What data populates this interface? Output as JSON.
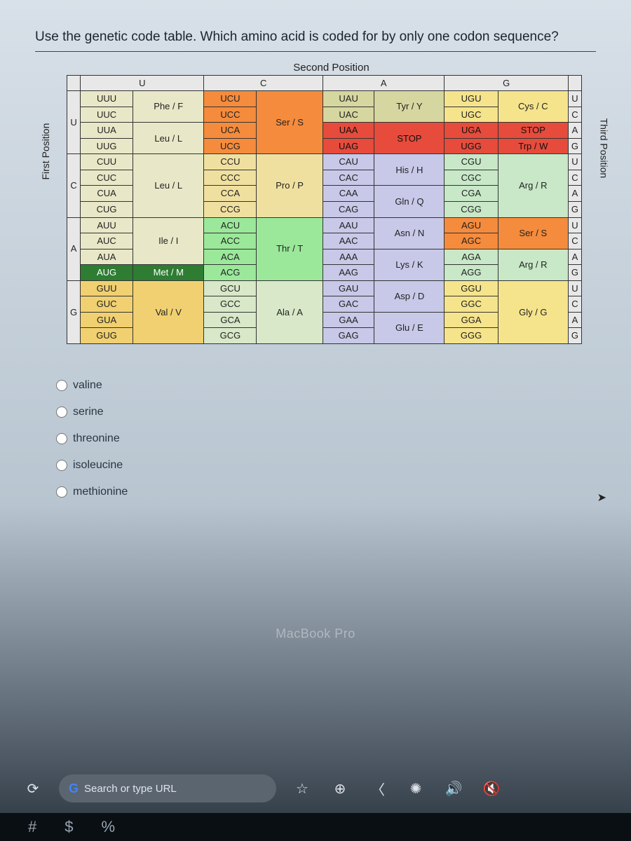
{
  "question": "Use the genetic code table. Which amino acid is coded for by only one codon sequence?",
  "labels": {
    "second": "Second Position",
    "first": "First Position",
    "third": "Third Position"
  },
  "headers": {
    "U": "U",
    "C": "C",
    "A": "A",
    "G": "G"
  },
  "rows": [
    "U",
    "C",
    "A",
    "G"
  ],
  "thirds": [
    "U",
    "C",
    "A",
    "G"
  ],
  "codon_table": {
    "U": {
      "U": {
        "codons": [
          "UUU",
          "UUC",
          "UUA",
          "UUG"
        ],
        "aa": [
          "Phe / F",
          "Phe / F",
          "Leu / L",
          "Leu / L"
        ]
      },
      "C": {
        "codons": [
          "UCU",
          "UCC",
          "UCA",
          "UCG"
        ],
        "aa": [
          "Ser / S",
          "Ser / S",
          "Ser / S",
          "Ser / S"
        ]
      },
      "A": {
        "codons": [
          "UAU",
          "UAC",
          "UAA",
          "UAG"
        ],
        "aa": [
          "Tyr / Y",
          "Tyr / Y",
          "STOP",
          "STOP"
        ]
      },
      "G": {
        "codons": [
          "UGU",
          "UGC",
          "UGA",
          "UGG"
        ],
        "aa": [
          "Cys / C",
          "Cys / C",
          "STOP",
          "Trp / W"
        ]
      }
    },
    "C": {
      "U": {
        "codons": [
          "CUU",
          "CUC",
          "CUA",
          "CUG"
        ],
        "aa": [
          "Leu / L",
          "Leu / L",
          "Leu / L",
          "Leu / L"
        ]
      },
      "C": {
        "codons": [
          "CCU",
          "CCC",
          "CCA",
          "CCG"
        ],
        "aa": [
          "Pro / P",
          "Pro / P",
          "Pro / P",
          "Pro / P"
        ]
      },
      "A": {
        "codons": [
          "CAU",
          "CAC",
          "CAA",
          "CAG"
        ],
        "aa": [
          "His / H",
          "His / H",
          "Gln / Q",
          "Gln / Q"
        ]
      },
      "G": {
        "codons": [
          "CGU",
          "CGC",
          "CGA",
          "CGG"
        ],
        "aa": [
          "Arg / R",
          "Arg / R",
          "Arg / R",
          "Arg / R"
        ]
      }
    },
    "A": {
      "U": {
        "codons": [
          "AUU",
          "AUC",
          "AUA",
          "AUG"
        ],
        "aa": [
          "Ile / I",
          "Ile / I",
          "Ile / I",
          "Met / M"
        ]
      },
      "C": {
        "codons": [
          "ACU",
          "ACC",
          "ACA",
          "ACG"
        ],
        "aa": [
          "Thr / T",
          "Thr / T",
          "Thr / T",
          "Thr / T"
        ]
      },
      "A": {
        "codons": [
          "AAU",
          "AAC",
          "AAA",
          "AAG"
        ],
        "aa": [
          "Asn / N",
          "Asn / N",
          "Lys / K",
          "Lys / K"
        ]
      },
      "G": {
        "codons": [
          "AGU",
          "AGC",
          "AGA",
          "AGG"
        ],
        "aa": [
          "Ser / S",
          "Ser / S",
          "Arg / R",
          "Arg / R"
        ]
      }
    },
    "G": {
      "U": {
        "codons": [
          "GUU",
          "GUC",
          "GUA",
          "GUG"
        ],
        "aa": [
          "Val / V",
          "Val / V",
          "Val / V",
          "Val / V"
        ]
      },
      "C": {
        "codons": [
          "GCU",
          "GCC",
          "GCA",
          "GCG"
        ],
        "aa": [
          "Ala / A",
          "Ala / A",
          "Ala / A",
          "Ala / A"
        ]
      },
      "A": {
        "codons": [
          "GAU",
          "GAC",
          "GAA",
          "GAG"
        ],
        "aa": [
          "Asp / D",
          "Asp / D",
          "Glu / E",
          "Glu / E"
        ]
      },
      "G": {
        "codons": [
          "GGU",
          "GGC",
          "GGA",
          "GGG"
        ],
        "aa": [
          "Gly / G",
          "Gly / G",
          "Gly / G",
          "Gly / G"
        ]
      }
    }
  },
  "aa_class": {
    "Phe / F": "phe",
    "Leu / L": "leu",
    "Ser / S": "ser",
    "Tyr / Y": "tyr",
    "STOP": "stop",
    "Cys / C": "cys",
    "Trp / W": "trp",
    "His / H": "his",
    "Gln / Q": "gln",
    "Pro / P": "pro",
    "Arg / R": "arg",
    "Ile / I": "ile",
    "Met / M": "met",
    "Thr / T": "thr",
    "Asn / N": "asn",
    "Lys / K": "lys",
    "Val / V": "val",
    "Ala / A": "ala",
    "Asp / D": "asp",
    "Glu / E": "glu",
    "Gly / G": "gly"
  },
  "options": [
    "valine",
    "serine",
    "threonine",
    "isoleucine",
    "methionine"
  ],
  "laptop": "MacBook Pro",
  "search_placeholder": "Search or type URL",
  "bottom_keys": [
    "#",
    "$",
    "%"
  ]
}
